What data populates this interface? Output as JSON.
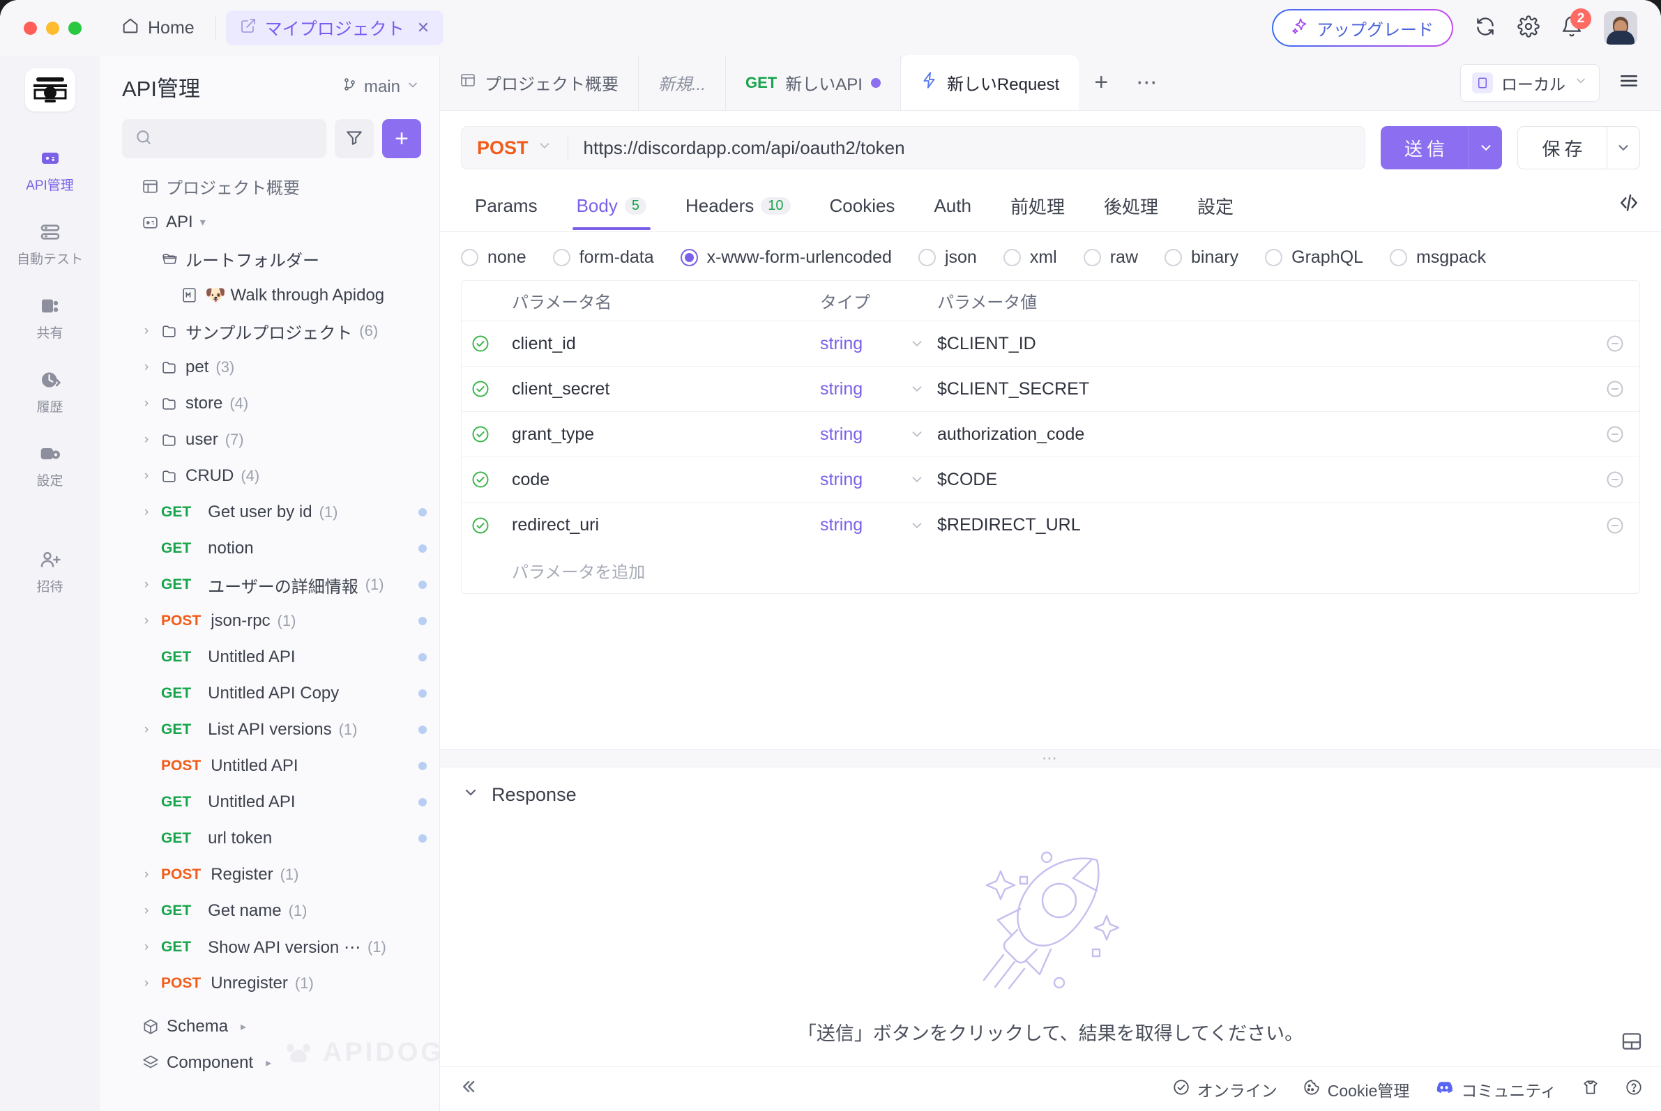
{
  "titlebar": {
    "home_label": "Home",
    "project_tab": "マイプロジェクト",
    "project_tab_close": "✕",
    "upgrade_label": "アップグレード",
    "notification_count": "2",
    "icons": [
      "sparkle-icon",
      "sync-icon",
      "gear-icon",
      "bell-icon",
      "avatar"
    ]
  },
  "rail": {
    "items": [
      {
        "label": "API管理",
        "icon": "api-management-icon",
        "active": true
      },
      {
        "label": "自動テスト",
        "icon": "automated-test-icon",
        "active": false
      },
      {
        "label": "共有",
        "icon": "share-icon",
        "active": false
      },
      {
        "label": "履歴",
        "icon": "history-icon",
        "active": false
      },
      {
        "label": "設定",
        "icon": "settings-icon",
        "active": false
      },
      {
        "label": "招待",
        "icon": "invite-icon",
        "active": false
      }
    ]
  },
  "sidebar": {
    "title": "API管理",
    "branch": "main",
    "search_placeholder": "",
    "filter_icon": "filter-icon",
    "add_label": "+",
    "project_overview": "プロジェクト概要",
    "api_group": "API",
    "tree": [
      {
        "indent": 1,
        "caret": false,
        "icon": "folder-open-icon",
        "label": "ルートフォルダー",
        "count": "",
        "method": "",
        "dot": false
      },
      {
        "indent": 2,
        "caret": false,
        "icon": "markdown-icon",
        "label": "🐶 Walk through Apidog",
        "count": "",
        "method": "",
        "dot": false
      },
      {
        "indent": 1,
        "caret": true,
        "icon": "folder-icon",
        "label": "サンプルプロジェクト",
        "count": "(6)",
        "method": "",
        "dot": false
      },
      {
        "indent": 1,
        "caret": true,
        "icon": "folder-icon",
        "label": "pet",
        "count": "(3)",
        "method": "",
        "dot": false
      },
      {
        "indent": 1,
        "caret": true,
        "icon": "folder-icon",
        "label": "store",
        "count": "(4)",
        "method": "",
        "dot": false
      },
      {
        "indent": 1,
        "caret": true,
        "icon": "folder-icon",
        "label": "user",
        "count": "(7)",
        "method": "",
        "dot": false
      },
      {
        "indent": 1,
        "caret": true,
        "icon": "folder-icon",
        "label": "CRUD",
        "count": "(4)",
        "method": "",
        "dot": false
      },
      {
        "indent": 1,
        "caret": true,
        "icon": "",
        "label": "Get user by id",
        "count": "(1)",
        "method": "GET",
        "dot": true
      },
      {
        "indent": 1,
        "caret": false,
        "icon": "",
        "label": "notion",
        "count": "",
        "method": "GET",
        "dot": true
      },
      {
        "indent": 1,
        "caret": true,
        "icon": "",
        "label": "ユーザーの詳細情報",
        "count": "(1)",
        "method": "GET",
        "dot": true
      },
      {
        "indent": 1,
        "caret": true,
        "icon": "",
        "label": "json-rpc",
        "count": "(1)",
        "method": "POST",
        "dot": true
      },
      {
        "indent": 1,
        "caret": false,
        "icon": "",
        "label": "Untitled API",
        "count": "",
        "method": "GET",
        "dot": true
      },
      {
        "indent": 1,
        "caret": false,
        "icon": "",
        "label": "Untitled API Copy",
        "count": "",
        "method": "GET",
        "dot": true
      },
      {
        "indent": 1,
        "caret": true,
        "icon": "",
        "label": "List API versions",
        "count": "(1)",
        "method": "GET",
        "dot": true
      },
      {
        "indent": 1,
        "caret": false,
        "icon": "",
        "label": "Untitled API",
        "count": "",
        "method": "POST",
        "dot": true
      },
      {
        "indent": 1,
        "caret": false,
        "icon": "",
        "label": "Untitled API",
        "count": "",
        "method": "GET",
        "dot": true
      },
      {
        "indent": 1,
        "caret": false,
        "icon": "",
        "label": "url token",
        "count": "",
        "method": "GET",
        "dot": true
      },
      {
        "indent": 1,
        "caret": true,
        "icon": "",
        "label": "Register",
        "count": "(1)",
        "method": "POST",
        "dot": false
      },
      {
        "indent": 1,
        "caret": true,
        "icon": "",
        "label": "Get name",
        "count": "(1)",
        "method": "GET",
        "dot": false
      },
      {
        "indent": 1,
        "caret": true,
        "icon": "",
        "label": "Show API version ⋯",
        "count": "(1)",
        "method": "GET",
        "dot": false
      },
      {
        "indent": 1,
        "caret": true,
        "icon": "",
        "label": "Unregister",
        "count": "(1)",
        "method": "POST",
        "dot": false
      }
    ],
    "schema_label": "Schema",
    "component_label": "Component",
    "watermark": "APIDOG"
  },
  "editor_tabs": {
    "tabs": [
      {
        "label": "プロジェクト概要",
        "icon": "overview-icon",
        "italic": false,
        "active": false,
        "method": "",
        "dirty": false
      },
      {
        "label": "新規...",
        "icon": "",
        "italic": true,
        "active": false,
        "method": "",
        "dirty": false
      },
      {
        "label": "新しいAPI",
        "icon": "",
        "italic": false,
        "active": false,
        "method": "GET",
        "dirty": true
      },
      {
        "label": "新しいRequest",
        "icon": "bolt-icon",
        "italic": false,
        "active": true,
        "method": "",
        "dirty": false
      }
    ],
    "add_tab": "+",
    "more_tabs": "⋯",
    "environment": "ローカル",
    "menu_icon": "hamburger-icon"
  },
  "request": {
    "method": "POST",
    "url": "https://discordapp.com/api/oauth2/token",
    "send_label": "送信",
    "save_label": "保存",
    "tabs": [
      {
        "label": "Params",
        "count": "",
        "active": false
      },
      {
        "label": "Body",
        "count": "5",
        "active": true
      },
      {
        "label": "Headers",
        "count": "10",
        "active": false
      },
      {
        "label": "Cookies",
        "count": "",
        "active": false
      },
      {
        "label": "Auth",
        "count": "",
        "active": false
      },
      {
        "label": "前処理",
        "count": "",
        "active": false
      },
      {
        "label": "後処理",
        "count": "",
        "active": false
      },
      {
        "label": "設定",
        "count": "",
        "active": false
      }
    ],
    "code_icon": "code-brackets-icon",
    "body_types": [
      {
        "label": "none",
        "selected": false
      },
      {
        "label": "form-data",
        "selected": false
      },
      {
        "label": "x-www-form-urlencoded",
        "selected": true
      },
      {
        "label": "json",
        "selected": false
      },
      {
        "label": "xml",
        "selected": false
      },
      {
        "label": "raw",
        "selected": false
      },
      {
        "label": "binary",
        "selected": false
      },
      {
        "label": "GraphQL",
        "selected": false
      },
      {
        "label": "msgpack",
        "selected": false
      }
    ],
    "table": {
      "headers": {
        "name": "パラメータ名",
        "type": "タイプ",
        "value": "パラメータ値"
      },
      "rows": [
        {
          "checked": true,
          "name": "client_id",
          "type": "string",
          "value": "$CLIENT_ID"
        },
        {
          "checked": true,
          "name": "client_secret",
          "type": "string",
          "value": "$CLIENT_SECRET"
        },
        {
          "checked": true,
          "name": "grant_type",
          "type": "string",
          "value": "authorization_code"
        },
        {
          "checked": true,
          "name": "code",
          "type": "string",
          "value": "$CODE"
        },
        {
          "checked": true,
          "name": "redirect_uri",
          "type": "string",
          "value": "$REDIRECT_URL"
        }
      ],
      "add_placeholder": "パラメータを追加"
    }
  },
  "response": {
    "title": "Response",
    "empty_message": "「送信」ボタンをクリックして、結果を取得してください。",
    "illustration": "rocket-icon"
  },
  "statusbar": {
    "collapse_icon": "collapse-icon",
    "items": [
      {
        "label": "オンライン",
        "icon": "check-circle-icon"
      },
      {
        "label": "Cookie管理",
        "icon": "cookie-icon"
      },
      {
        "label": "コミュニティ",
        "icon": "discord-icon"
      }
    ],
    "shirt_icon": "shirt-icon",
    "help_icon": "help-icon",
    "layout_icon": "layout-panel-icon"
  },
  "colors": {
    "accent": "#7b61e8",
    "get": "#17a44b",
    "post": "#f25c19",
    "badge": "#ff6b63"
  }
}
